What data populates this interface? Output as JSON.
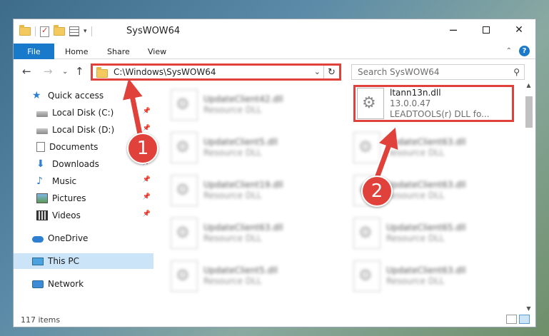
{
  "window": {
    "title": "SysWOW64"
  },
  "ribbon": {
    "tabs": [
      "File",
      "Home",
      "Share",
      "View"
    ]
  },
  "nav": {
    "address": "C:\\Windows\\SysWOW64",
    "search_placeholder": "Search SysWOW64"
  },
  "sidebar": {
    "items": [
      {
        "label": "Quick access",
        "icon": "star-icon",
        "pinned": false
      },
      {
        "label": "Local Disk (C:)",
        "icon": "drive-icon",
        "pinned": true
      },
      {
        "label": "Local Disk (D:)",
        "icon": "drive-icon",
        "pinned": true
      },
      {
        "label": "Documents",
        "icon": "documents-icon",
        "pinned": true
      },
      {
        "label": "Downloads",
        "icon": "download-icon",
        "pinned": true
      },
      {
        "label": "Music",
        "icon": "music-icon",
        "pinned": true
      },
      {
        "label": "Pictures",
        "icon": "pictures-icon",
        "pinned": true
      },
      {
        "label": "Videos",
        "icon": "videos-icon",
        "pinned": true
      },
      {
        "label": "OneDrive",
        "icon": "cloud-icon",
        "pinned": false
      },
      {
        "label": "This PC",
        "icon": "computer-icon",
        "pinned": false,
        "selected": true
      },
      {
        "label": "Network",
        "icon": "network-icon",
        "pinned": false
      }
    ]
  },
  "files": {
    "highlighted": {
      "name": "ltann13n.dll",
      "version": "13.0.0.47",
      "description": "LEADTOOLS(r) DLL fo..."
    },
    "left_column": [
      {
        "name": "UpdateClient42.dll",
        "type": "Resource DLL"
      },
      {
        "name": "UpdateClient5.dll",
        "type": "Resource DLL"
      },
      {
        "name": "UpdateClient19.dll",
        "type": "Resource DLL"
      },
      {
        "name": "UpdateClient63.dll",
        "type": "Resource DLL"
      },
      {
        "name": "UpdateClient5.dll",
        "type": "Resource DLL"
      }
    ],
    "right_column": [
      {
        "name": "UpdateClient63.dll",
        "type": "Resource DLL"
      },
      {
        "name": "UpdateClient63.dll",
        "type": "Resource DLL"
      },
      {
        "name": "UpdateClient65.dll",
        "type": "Resource DLL"
      },
      {
        "name": "UpdateClient63.dll",
        "type": "Resource DLL"
      }
    ]
  },
  "status": {
    "item_count": "117 items"
  },
  "annotations": {
    "step1": "1",
    "step2": "2"
  },
  "colors": {
    "accent": "#1979ca",
    "highlight": "#e0413a",
    "selection": "#cce4f7"
  }
}
